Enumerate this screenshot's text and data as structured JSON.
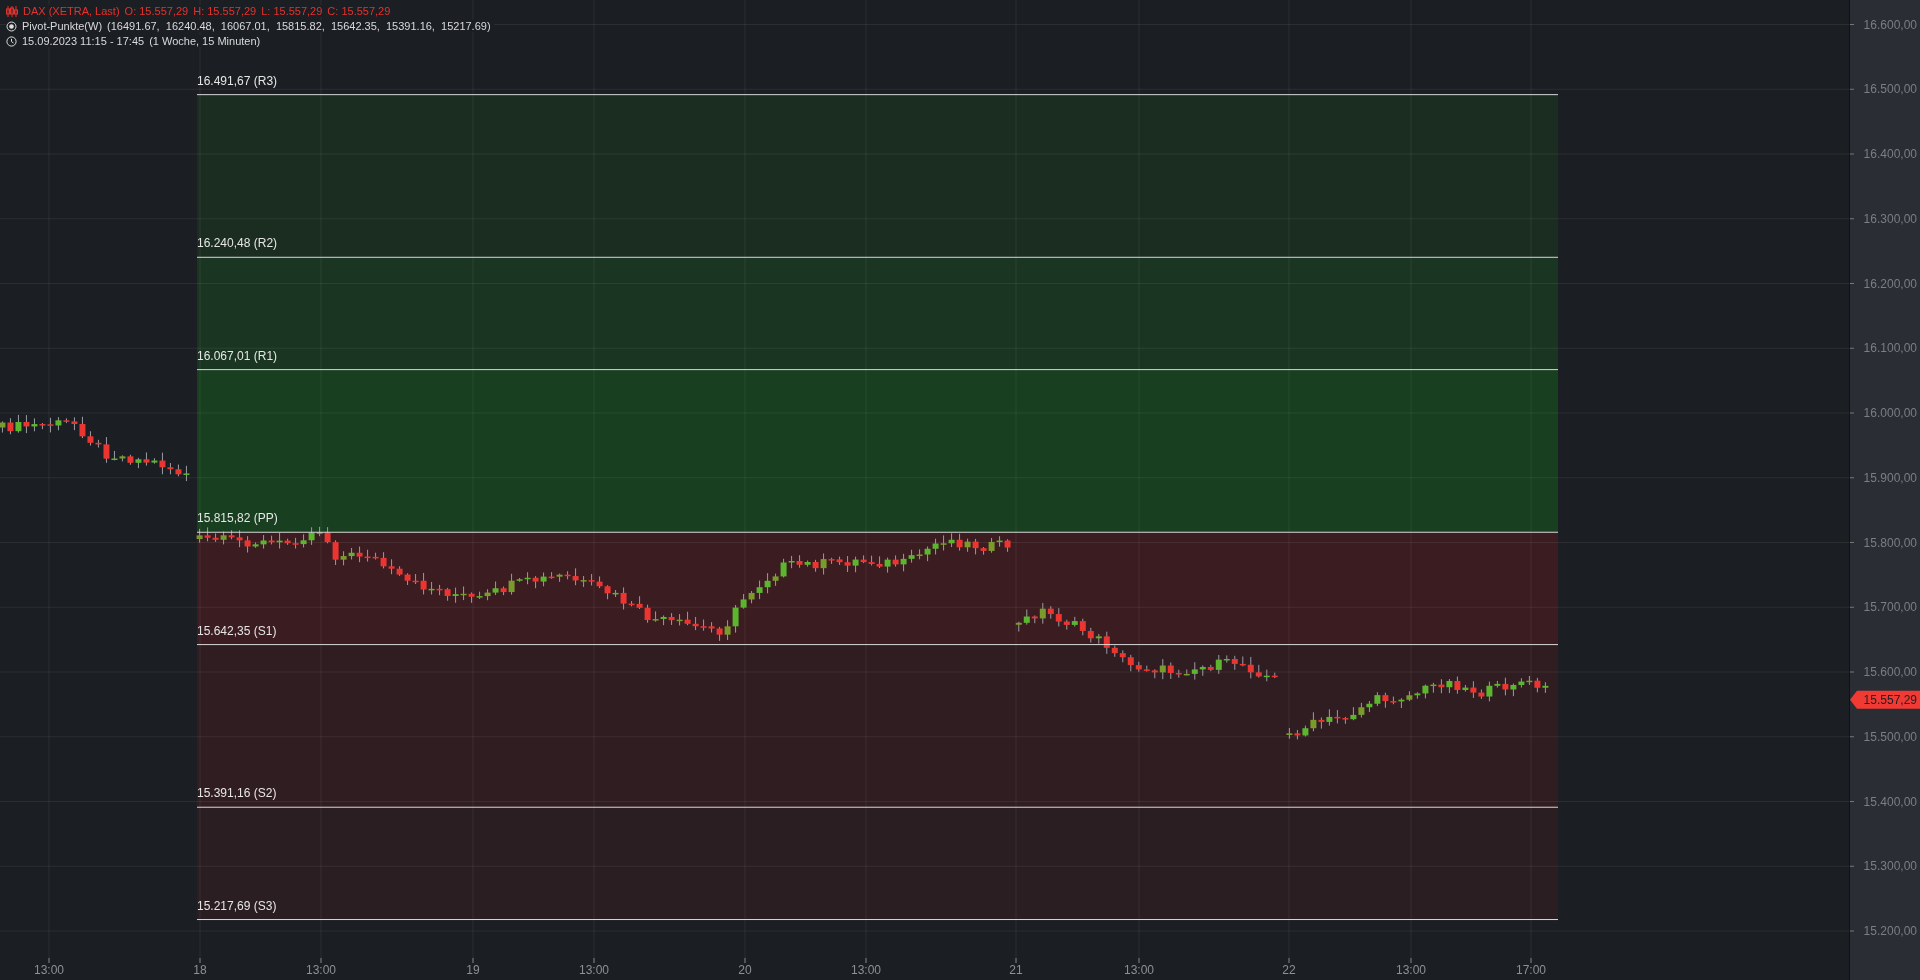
{
  "legend": {
    "instrument": "DAX (XETRA, Last)",
    "ohlc": [
      "O: 15.557,29",
      "H: 15.557,29",
      "L: 15.557,29",
      "C: 15.557,29"
    ],
    "indicator": "Pivot-Punkte(W)",
    "indicator_values": "(16491.67,  16240.48,  16067.01,  15815.82,  15642.35,  15391.16,  15217.69)",
    "period": "15.09.2023 11:15 - 17:45",
    "period_detail": "(1 Woche, 15 Minuten)"
  },
  "pivot_levels": [
    {
      "label": "16.491,67 (R3)"
    },
    {
      "label": "16.240,48 (R2)"
    },
    {
      "label": "16.067,01 (R1)"
    },
    {
      "label": "15.815,82 (PP)"
    },
    {
      "label": "15.642,35 (S1)"
    },
    {
      "label": "15.391,16 (S2)"
    },
    {
      "label": "15.217,69 (S3)"
    }
  ],
  "bands": [
    {
      "color": "#1b2c21"
    },
    {
      "color": "#1a3521"
    },
    {
      "color": "#183f1f"
    },
    {
      "color": "#3a1c21"
    },
    {
      "color": "#301d21"
    },
    {
      "color": "#2a1e22"
    }
  ],
  "price_axis": {
    "ticks": [
      "16.600,00",
      "16.500,00",
      "16.400,00",
      "16.300,00",
      "16.200,00",
      "16.100,00",
      "16.000,00",
      "15.900,00",
      "15.800,00",
      "15.700,00",
      "15.600,00",
      "15.500,00",
      "15.400,00",
      "15.300,00",
      "15.200,00"
    ],
    "last_price": "15.557,29"
  },
  "time_axis": {
    "labels": [
      "13:00",
      "18",
      "13:00",
      "19",
      "13:00",
      "20",
      "13:00",
      "21",
      "13:00",
      "22",
      "13:00",
      "17:00"
    ]
  }
}
